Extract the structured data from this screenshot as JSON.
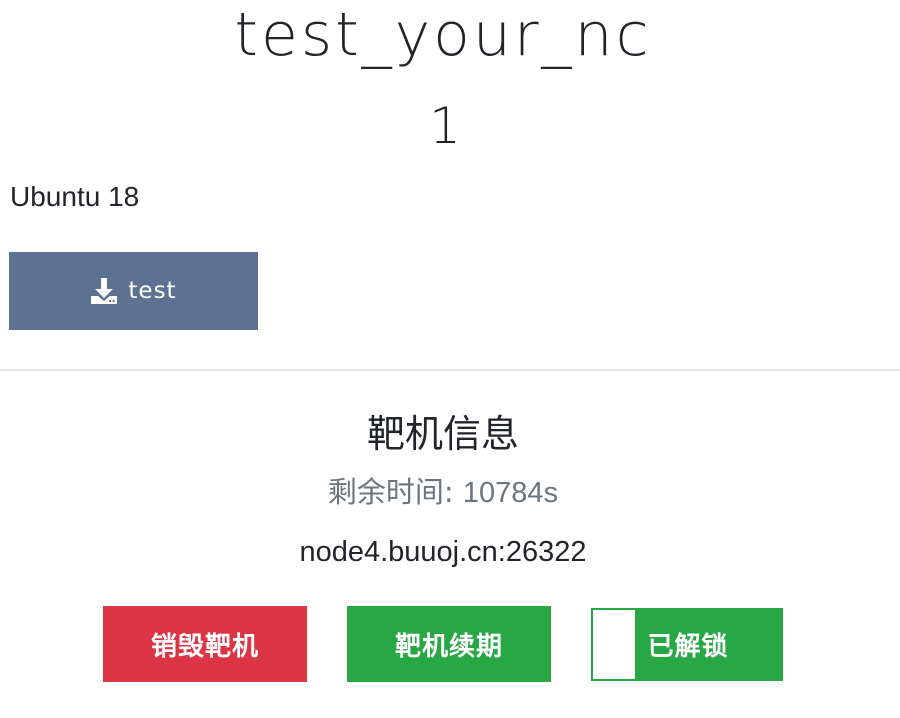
{
  "challenge": {
    "title": "test_your_nc",
    "points": "1",
    "description": "Ubuntu 18"
  },
  "download": {
    "label": "test",
    "icon": "download-icon"
  },
  "target": {
    "section_title": "靶机信息",
    "remaining_label": "剩余时间: ",
    "remaining_value": "10784s",
    "address": "node4.buuoj.cn:26322"
  },
  "actions": {
    "destroy_label": "销毁靶机",
    "renew_label": "靶机续期",
    "unlock_label": "已解锁"
  },
  "colors": {
    "download_button": "#5c7290",
    "danger": "#dc3545",
    "success": "#28a745",
    "muted_text": "#6c757d"
  }
}
